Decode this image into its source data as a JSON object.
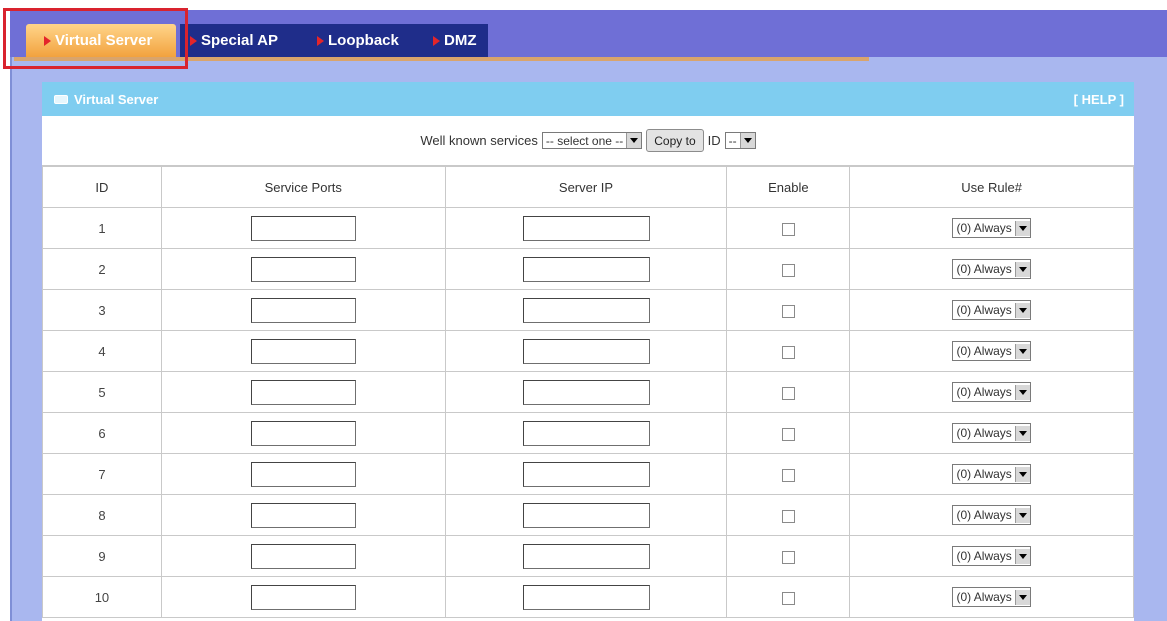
{
  "tabs": [
    {
      "label": "Virtual Server",
      "active": true
    },
    {
      "label": "Special AP",
      "active": false
    },
    {
      "label": "Loopback",
      "active": false
    },
    {
      "label": "DMZ",
      "active": false
    }
  ],
  "panel": {
    "title": "Virtual Server",
    "help_label": "[ HELP ]"
  },
  "toolbar": {
    "well_known_label": "Well known services",
    "service_select_value": "-- select one --",
    "copy_button_label": "Copy to",
    "id_label": "ID",
    "id_select_value": "--"
  },
  "table": {
    "headers": [
      "ID",
      "Service Ports",
      "Server IP",
      "Enable",
      "Use Rule#"
    ],
    "rows": [
      {
        "id": "1",
        "service_ports": "",
        "server_ip": "",
        "enabled": false,
        "rule": "(0) Always"
      },
      {
        "id": "2",
        "service_ports": "",
        "server_ip": "",
        "enabled": false,
        "rule": "(0) Always"
      },
      {
        "id": "3",
        "service_ports": "",
        "server_ip": "",
        "enabled": false,
        "rule": "(0) Always"
      },
      {
        "id": "4",
        "service_ports": "",
        "server_ip": "",
        "enabled": false,
        "rule": "(0) Always"
      },
      {
        "id": "5",
        "service_ports": "",
        "server_ip": "",
        "enabled": false,
        "rule": "(0) Always"
      },
      {
        "id": "6",
        "service_ports": "",
        "server_ip": "",
        "enabled": false,
        "rule": "(0) Always"
      },
      {
        "id": "7",
        "service_ports": "",
        "server_ip": "",
        "enabled": false,
        "rule": "(0) Always"
      },
      {
        "id": "8",
        "service_ports": "",
        "server_ip": "",
        "enabled": false,
        "rule": "(0) Always"
      },
      {
        "id": "9",
        "service_ports": "",
        "server_ip": "",
        "enabled": false,
        "rule": "(0) Always"
      },
      {
        "id": "10",
        "service_ports": "",
        "server_ip": "",
        "enabled": false,
        "rule": "(0) Always"
      }
    ]
  },
  "colors": {
    "tab_active": "#f2a23e",
    "tab_bar": "#6f6fd6",
    "tab_strip_navy": "#1f2d8a",
    "panel_header": "#7fcdf0",
    "highlight": "#d9232e"
  }
}
